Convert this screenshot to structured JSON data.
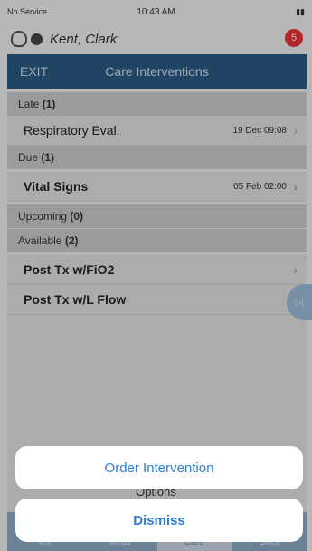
{
  "status_bar": {
    "carrier": "No Service",
    "time": "10:43 AM"
  },
  "patient": {
    "name": "Kent, Clark",
    "badge": "5"
  },
  "header": {
    "exit_label": "EXIT",
    "title": "Care Interventions"
  },
  "sections": {
    "late": {
      "label": "Late",
      "count": "(1)"
    },
    "due": {
      "label": "Due",
      "count": "(1)"
    },
    "upcoming": {
      "label": "Upcoming",
      "count": "(0)"
    },
    "available": {
      "label": "Available",
      "count": "(2)"
    }
  },
  "rows": {
    "late_item": {
      "label": "Respiratory Eval.",
      "date": "19 Dec 09:08"
    },
    "due_item": {
      "label": "Vital Signs",
      "date": "05 Feb 02:00"
    },
    "available_items": [
      "Post Tx w/FiO2",
      "Post Tx w/L Flow"
    ]
  },
  "tabs": [
    "Ins",
    "Meds",
    "Care",
    "Docs"
  ],
  "options_label": "Options",
  "action_sheet": {
    "order_label": "Order Intervention",
    "dismiss_label": "Dismiss"
  },
  "colors": {
    "header_blue": "#2b5d86",
    "action_blue": "#2e7fd4",
    "badge_red": "#e33333"
  }
}
